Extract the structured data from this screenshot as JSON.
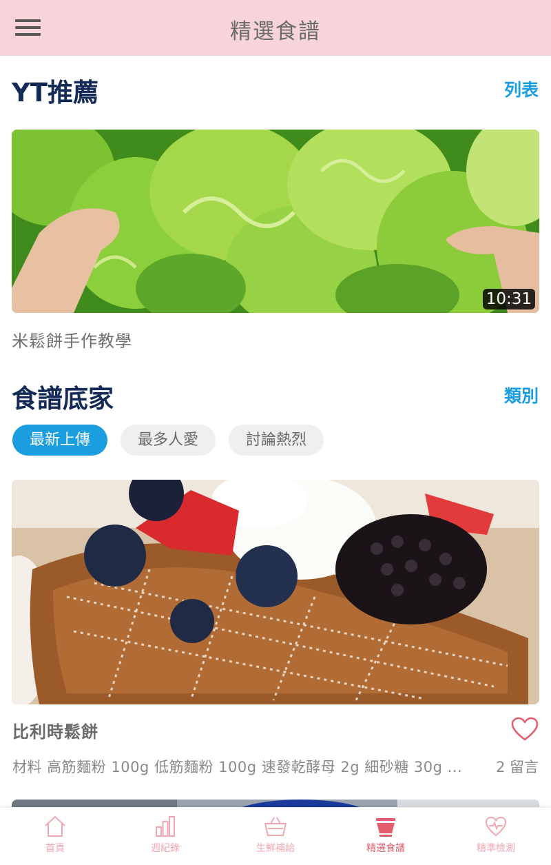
{
  "header": {
    "title": "精選食譜"
  },
  "yt_section": {
    "title": "YT推薦",
    "link_label": "列表",
    "video": {
      "duration": "10:31",
      "caption": "米鬆餅手作教學"
    }
  },
  "recipes_section": {
    "title": "食譜底家",
    "link_label": "類別",
    "filters": [
      {
        "label": "最新上傳",
        "active": true
      },
      {
        "label": "最多人愛",
        "active": false
      },
      {
        "label": "討論熱烈",
        "active": false
      }
    ],
    "card": {
      "title": "比利時鬆餅",
      "ingredients": "材料  高筋麵粉 100g  低筋麵粉 100g  速發乾酵母 2g  細砂糖 30g  ...",
      "comments": "2 留言"
    }
  },
  "bottom_nav": {
    "items": [
      {
        "label": "首頁",
        "icon": "home-icon"
      },
      {
        "label": "週紀錄",
        "icon": "bar-chart-icon"
      },
      {
        "label": "生鮮補給",
        "icon": "basket-icon"
      },
      {
        "label": "精選食譜",
        "icon": "bowl-icon",
        "active": true
      },
      {
        "label": "精準檢測",
        "icon": "heart-pulse-icon"
      }
    ]
  },
  "colors": {
    "header_bg": "#f7d4da",
    "accent_blue": "#1a9ee0",
    "heading_navy": "#122a55",
    "nav_active": "#e25d6d",
    "nav_inactive": "#f2a6b0"
  }
}
